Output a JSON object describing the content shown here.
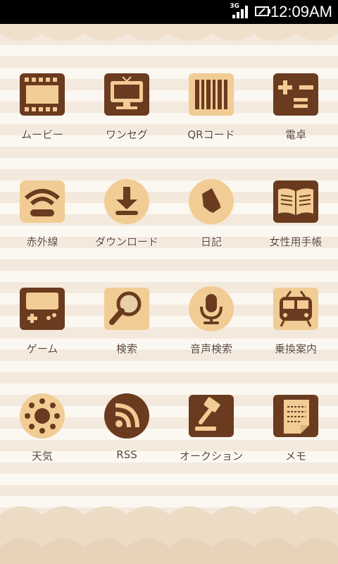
{
  "status_bar": {
    "network": "3G",
    "time": "12:09AM"
  },
  "colors": {
    "cookie_dark": "#6a3b1f",
    "cookie_light": "#f2cc95",
    "label": "#5a4332"
  },
  "apps": [
    {
      "label": "ムービー",
      "icon": "film-icon"
    },
    {
      "label": "ワンセグ",
      "icon": "tv-icon"
    },
    {
      "label": "QRコード",
      "icon": "barcode-icon"
    },
    {
      "label": "電卓",
      "icon": "calculator-icon"
    },
    {
      "label": "赤外線",
      "icon": "infrared-icon"
    },
    {
      "label": "ダウンロード",
      "icon": "download-icon"
    },
    {
      "label": "日記",
      "icon": "diary-icon"
    },
    {
      "label": "女性用手帳",
      "icon": "notebook-icon"
    },
    {
      "label": "ゲーム",
      "icon": "game-icon"
    },
    {
      "label": "検索",
      "icon": "search-icon"
    },
    {
      "label": "音声検索",
      "icon": "voice-search-icon"
    },
    {
      "label": "乗換案内",
      "icon": "train-icon"
    },
    {
      "label": "天気",
      "icon": "weather-icon"
    },
    {
      "label": "RSS",
      "icon": "rss-icon"
    },
    {
      "label": "オークション",
      "icon": "auction-icon"
    },
    {
      "label": "メモ",
      "icon": "memo-icon"
    }
  ]
}
